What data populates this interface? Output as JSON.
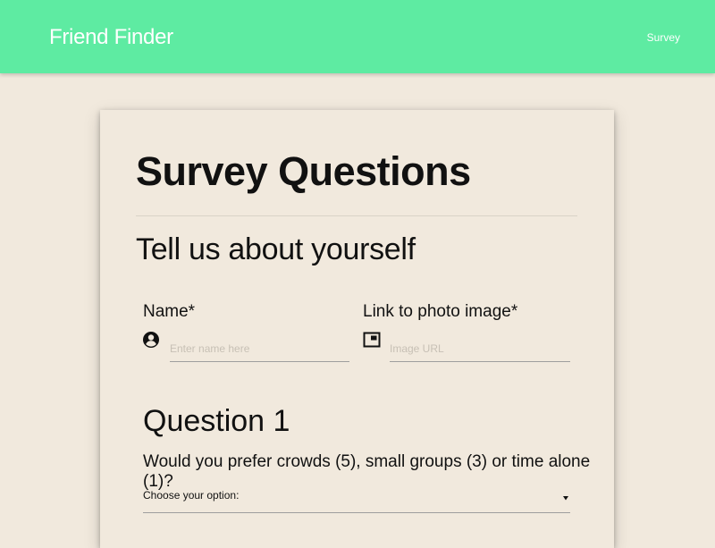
{
  "navbar": {
    "brand": "Friend Finder",
    "links": [
      {
        "label": "Survey"
      }
    ],
    "color": "#5eeba2"
  },
  "page": {
    "background": "#f1e9dd",
    "title": "Survey Questions",
    "section_heading": "Tell us about yourself"
  },
  "form": {
    "name": {
      "label": "Name*",
      "placeholder": "Enter name here",
      "value": "",
      "icon": "account-circle-icon"
    },
    "photo": {
      "label": "Link to photo image*",
      "placeholder": "Image URL",
      "value": "",
      "icon": "picture-in-picture-icon"
    }
  },
  "questions": [
    {
      "title": "Question 1",
      "text": "Would you prefer crowds (5), small groups (3) or time alone (1)?",
      "select": {
        "selected": "Choose your option:",
        "icon": "caret-down-icon"
      }
    }
  ]
}
